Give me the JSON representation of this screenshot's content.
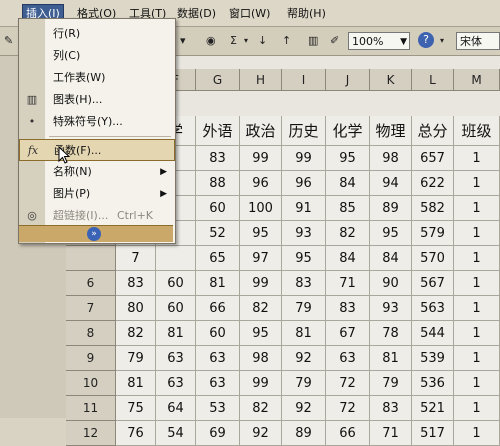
{
  "menubar": {
    "items": [
      {
        "label": "插入(I)",
        "active": true
      },
      {
        "label": "格式(O)"
      },
      {
        "label": "工具(T)"
      },
      {
        "label": "数据(D)"
      },
      {
        "label": "窗口(W)"
      },
      {
        "label": "帮助(H)"
      }
    ]
  },
  "toolbar": {
    "sigma": "Σ",
    "zoom": "100%",
    "font": "宋体"
  },
  "insert_menu": {
    "items": [
      {
        "label": "行(R)",
        "icon": "row-icon"
      },
      {
        "label": "列(C)",
        "icon": "column-icon"
      },
      {
        "label": "工作表(W)",
        "icon": "worksheet-icon"
      },
      {
        "label": "图表(H)...",
        "icon": "chart-icon"
      },
      {
        "label": "特殊符号(Y)...",
        "icon": "symbol-icon"
      },
      {
        "label": "函数(F)...",
        "icon": "function-icon",
        "glyph": "fx"
      },
      {
        "label": "名称(N)",
        "icon": "name-icon",
        "submenu": true
      },
      {
        "label": "图片(P)",
        "icon": "picture-icon",
        "submenu": true
      },
      {
        "label": "超链接(I)...",
        "icon": "hyperlink-icon",
        "shortcut": "Ctrl+K",
        "disabled": true
      }
    ],
    "expand_glyph": "»"
  },
  "sheet": {
    "columns": [
      "F",
      "G",
      "H",
      "I",
      "J",
      "K",
      "L",
      "M"
    ],
    "header_row": [
      "学",
      "外语",
      "政治",
      "历史",
      "化学",
      "物理",
      "总分",
      "班级"
    ],
    "rows": [
      {
        "n": "",
        "partial": "7",
        "cells": [
          "",
          "83",
          "99",
          "99",
          "95",
          "98",
          "657",
          "1"
        ]
      },
      {
        "n": "",
        "partial": "0",
        "cells": [
          "",
          "88",
          "96",
          "96",
          "84",
          "94",
          "622",
          "1"
        ]
      },
      {
        "n": "",
        "partial": "0",
        "cells": [
          "",
          "60",
          "100",
          "91",
          "85",
          "89",
          "582",
          "1"
        ]
      },
      {
        "n": "",
        "partial": "7",
        "cells": [
          "",
          "52",
          "95",
          "93",
          "82",
          "95",
          "579",
          "1"
        ]
      },
      {
        "n": "",
        "partial": "7",
        "cells": [
          "",
          "65",
          "97",
          "95",
          "84",
          "84",
          "570",
          "1"
        ]
      },
      {
        "n": "6",
        "partial": "83",
        "cells": [
          "60",
          "81",
          "99",
          "83",
          "71",
          "90",
          "567",
          "1"
        ]
      },
      {
        "n": "7",
        "partial": "80",
        "cells": [
          "60",
          "66",
          "82",
          "79",
          "83",
          "93",
          "563",
          "1"
        ]
      },
      {
        "n": "8",
        "partial": "82",
        "cells": [
          "81",
          "60",
          "95",
          "81",
          "67",
          "78",
          "544",
          "1"
        ]
      },
      {
        "n": "9",
        "partial": "79",
        "cells": [
          "63",
          "63",
          "98",
          "92",
          "63",
          "81",
          "539",
          "1"
        ]
      },
      {
        "n": "10",
        "partial": "81",
        "cells": [
          "63",
          "63",
          "99",
          "79",
          "72",
          "79",
          "536",
          "1"
        ]
      },
      {
        "n": "11",
        "partial": "75",
        "cells": [
          "64",
          "53",
          "82",
          "92",
          "72",
          "83",
          "521",
          "1"
        ]
      },
      {
        "n": "12",
        "partial": "76",
        "cells": [
          "54",
          "69",
          "92",
          "89",
          "66",
          "71",
          "517",
          "1"
        ]
      }
    ]
  }
}
